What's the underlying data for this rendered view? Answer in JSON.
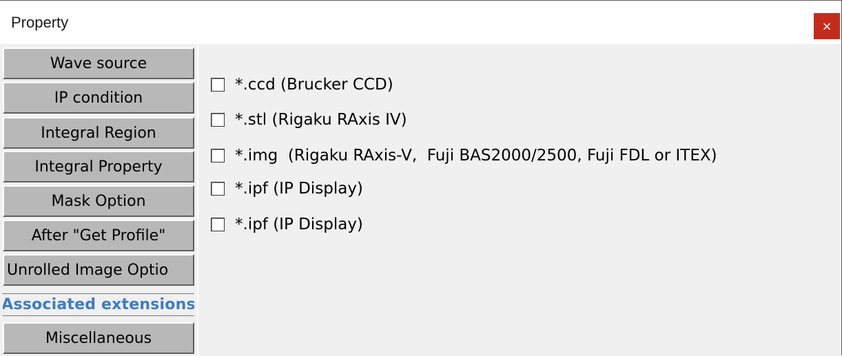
{
  "window": {
    "title": "Property",
    "close_label": "×"
  },
  "tabs": [
    {
      "label": "Wave source",
      "active": false
    },
    {
      "label": "IP condition",
      "active": false
    },
    {
      "label": "Integral Region",
      "active": false
    },
    {
      "label": "Integral Property",
      "active": false
    },
    {
      "label": "Mask Option",
      "active": false
    },
    {
      "label": "After \"Get Profile\"",
      "active": false
    },
    {
      "label": "Unrolled  Image Optio",
      "active": false
    },
    {
      "label": "Associated extensions",
      "active": true
    },
    {
      "label": "Miscellaneous",
      "active": false
    }
  ],
  "options": [
    {
      "label": "*.ccd (Brucker CCD)",
      "checked": false
    },
    {
      "label": "*.stl (Rigaku RAxis IV)",
      "checked": false
    },
    {
      "label": "*.img  (Rigaku RAxis-V,  Fuji BAS2000/2500, Fuji FDL or ITEX)",
      "checked": false
    },
    {
      "label": "*.ipf (IP Display)",
      "checked": false
    },
    {
      "label": "*.ipf (IP Display)",
      "checked": false
    }
  ],
  "colors": {
    "close_bg": "#c42b1c",
    "active_tab_text": "#3d7cc1",
    "tab_bg": "#b8b8b8",
    "panel_bg": "#f0f0f0"
  }
}
